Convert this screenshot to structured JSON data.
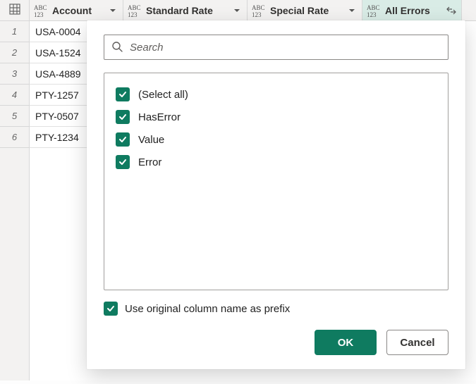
{
  "columns": [
    {
      "label": "Account",
      "active": false,
      "filter": "caret"
    },
    {
      "label": "Standard Rate",
      "active": false,
      "filter": "caret"
    },
    {
      "label": "Special Rate",
      "active": false,
      "filter": "caret"
    },
    {
      "label": "All Errors",
      "active": true,
      "filter": "expand"
    }
  ],
  "rows": [
    {
      "num": "1",
      "account": "USA-0004"
    },
    {
      "num": "2",
      "account": "USA-1524"
    },
    {
      "num": "3",
      "account": "USA-4889"
    },
    {
      "num": "4",
      "account": "PTY-1257"
    },
    {
      "num": "5",
      "account": "PTY-0507"
    },
    {
      "num": "6",
      "account": "PTY-1234"
    }
  ],
  "popup": {
    "search_placeholder": "Search",
    "options": [
      {
        "label": "(Select all)",
        "checked": true
      },
      {
        "label": "HasError",
        "checked": true
      },
      {
        "label": "Value",
        "checked": true
      },
      {
        "label": "Error",
        "checked": true
      }
    ],
    "prefix_checked": true,
    "prefix_label": "Use original column name as prefix",
    "ok_label": "OK",
    "cancel_label": "Cancel"
  }
}
